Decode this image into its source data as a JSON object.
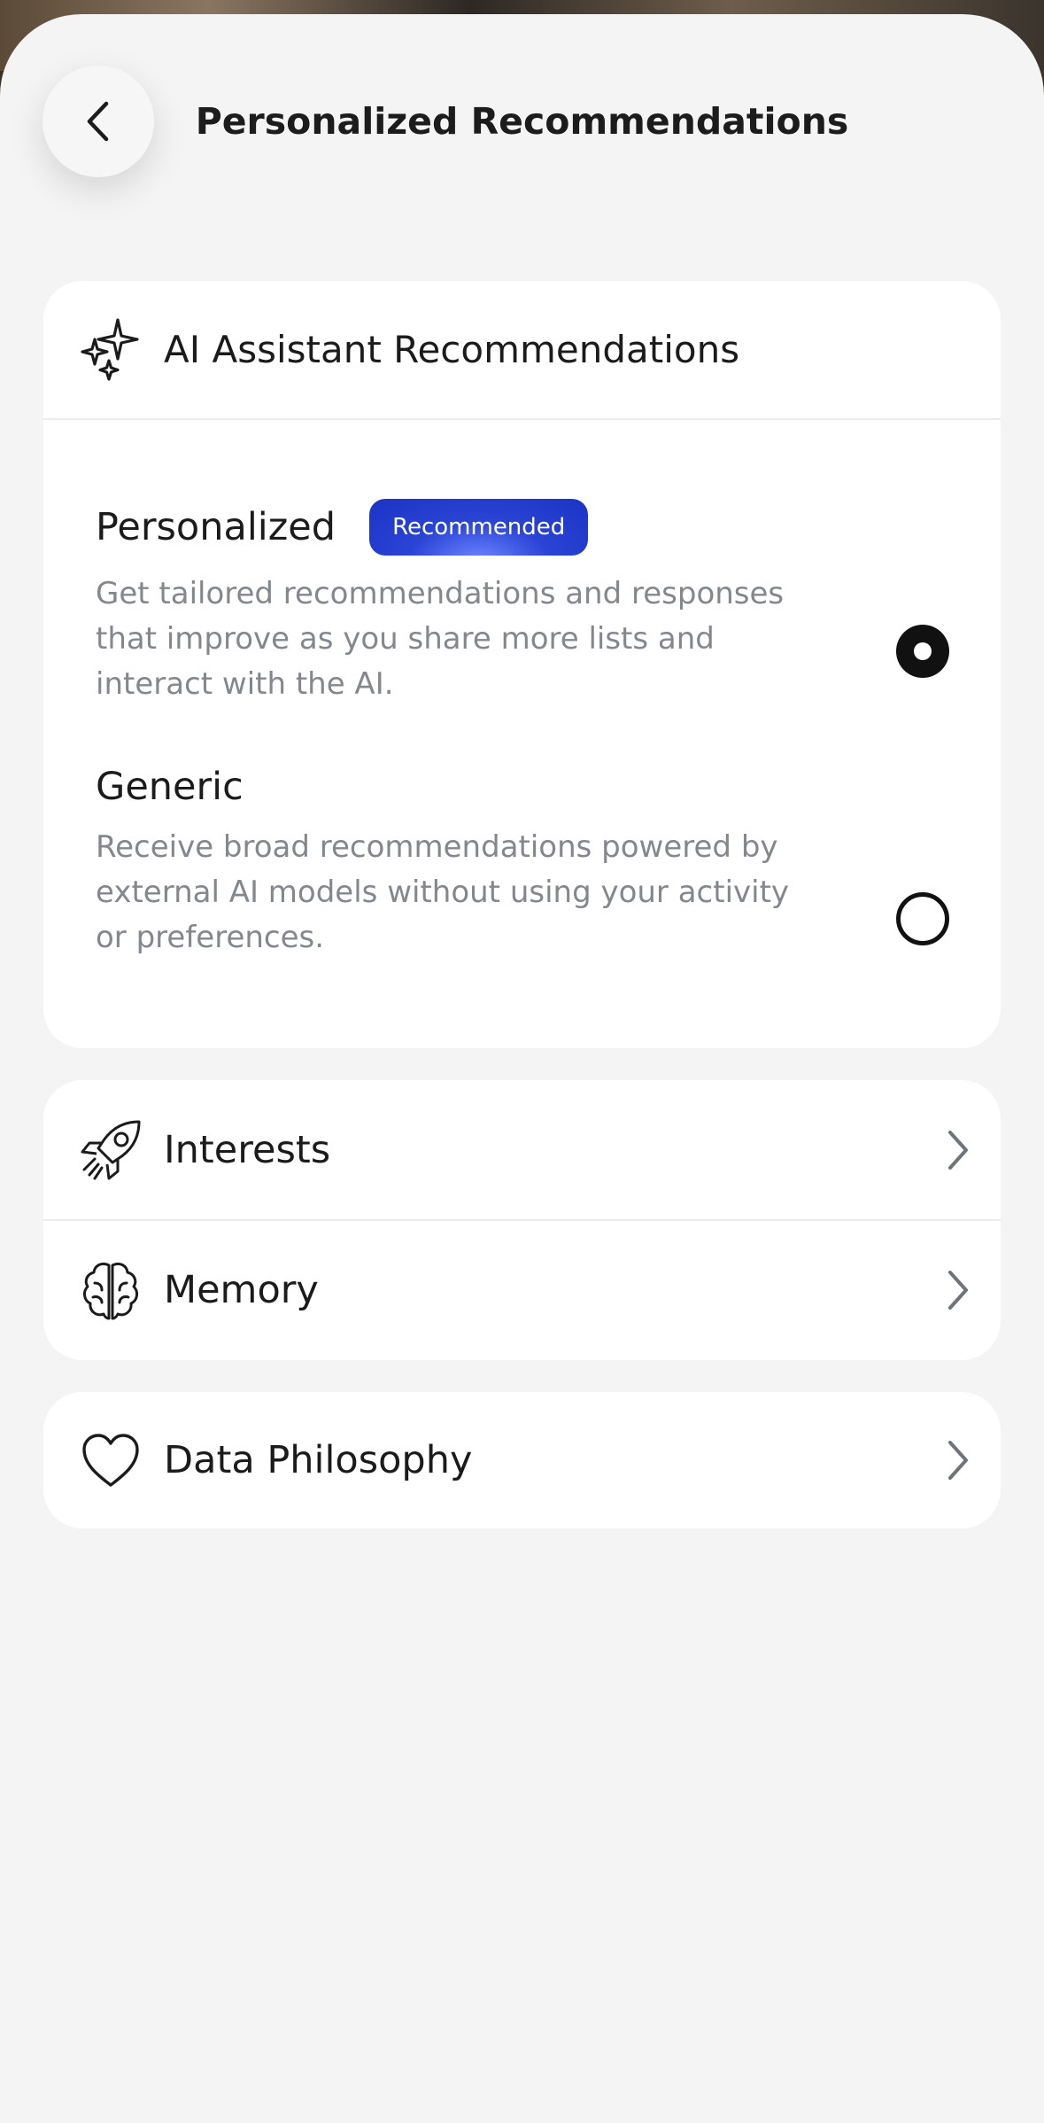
{
  "header": {
    "title": "Personalized Recommendations"
  },
  "ai_card": {
    "title": "AI Assistant Recommendations",
    "options": [
      {
        "title": "Personalized",
        "badge": "Recommended",
        "description": "Get tailored recommendations and responses that improve as you share more lists and interact with the AI.",
        "selected": true
      },
      {
        "title": "Generic",
        "description": "Receive broad recommendations powered by external AI models without using your activity or preferences.",
        "selected": false
      }
    ]
  },
  "links": [
    {
      "label": "Interests",
      "icon": "rocket-icon"
    },
    {
      "label": "Memory",
      "icon": "brain-icon"
    },
    {
      "label": "Data Philosophy",
      "icon": "heart-icon"
    }
  ],
  "colors": {
    "background": "#f4f4f4",
    "card": "#ffffff",
    "badge": "#1c33c4",
    "muted_text": "#84878c"
  }
}
